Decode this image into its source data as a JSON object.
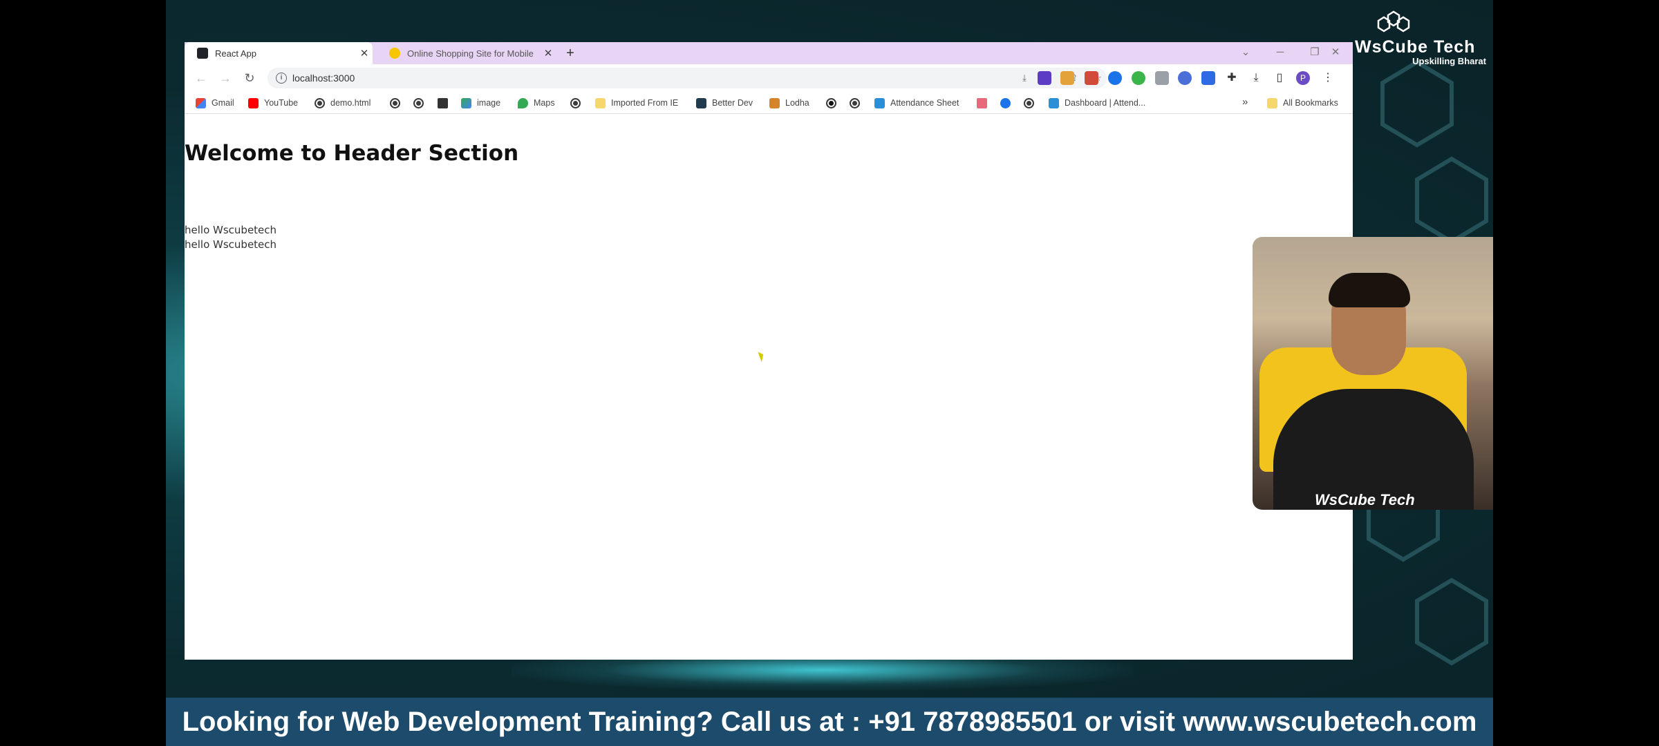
{
  "browser": {
    "tabs": [
      {
        "title": "React App",
        "active": true
      },
      {
        "title": "Online Shopping Site for Mobile",
        "active": false
      }
    ],
    "url": "localhost:3000",
    "profile_initial": "P",
    "bookmarks": [
      {
        "label": "Gmail",
        "icon": "gmail-icon"
      },
      {
        "label": "YouTube",
        "icon": "youtube-icon"
      },
      {
        "label": "demo.html",
        "icon": "globe-icon"
      },
      {
        "label": "image",
        "icon": "image-icon"
      },
      {
        "label": "Maps",
        "icon": "maps-icon"
      },
      {
        "label": "Imported From IE",
        "icon": "folder-icon"
      },
      {
        "label": "Better Dev",
        "icon": "betterdev-icon"
      },
      {
        "label": "Lodha",
        "icon": "lodha-icon"
      },
      {
        "label": "Attendance Sheet",
        "icon": "vr-icon"
      },
      {
        "label": "Dashboard | Attend...",
        "icon": "vr-icon"
      }
    ],
    "overflow_label": "»",
    "all_bookmarks_label": "All Bookmarks"
  },
  "page": {
    "heading": "Welcome to Header Section",
    "lines": [
      "hello Wscubetech",
      "hello Wscubetech"
    ]
  },
  "brand": {
    "name": "WsCube Tech",
    "tagline": "Upskilling Bharat"
  },
  "webcam": {
    "watermark": "WsCube Tech"
  },
  "banner": {
    "text": "Looking for Web Development Training? Call us at : +91 7878985501 or visit www.wscubetech.com"
  },
  "colors": {
    "tabstrip": "#e8d4f4",
    "banner": "#1c4b6b",
    "background": "#0b2a30"
  }
}
